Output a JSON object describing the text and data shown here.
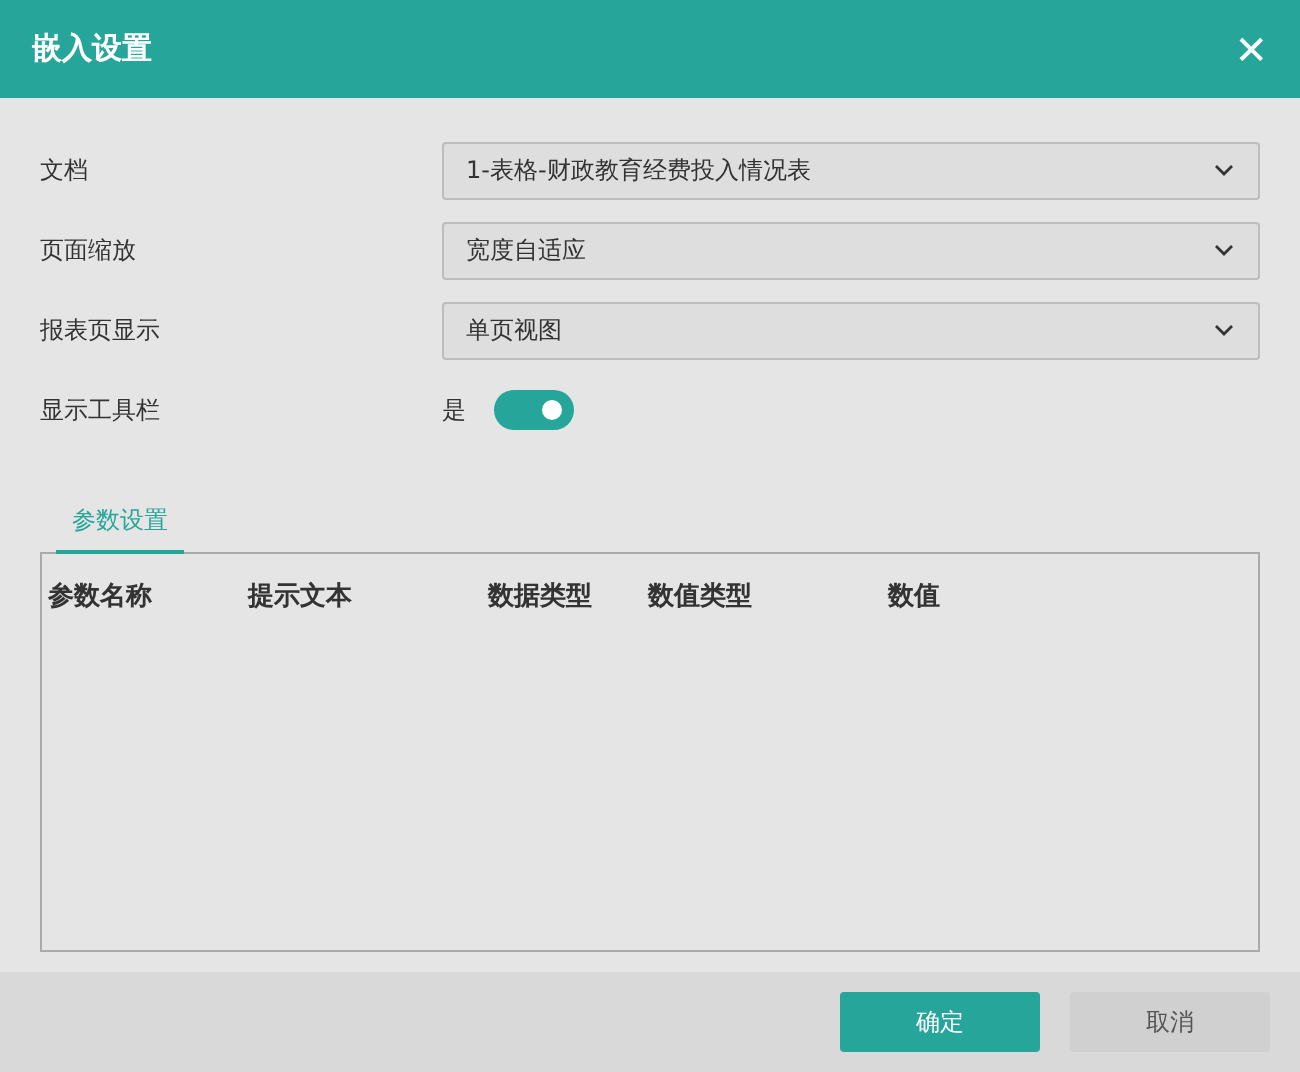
{
  "window": {
    "title": "嵌入设置",
    "close": "✕"
  },
  "fields": [
    {
      "kind": "select",
      "label": "文档",
      "value": "1-表格-财政教育经费投入情况表"
    },
    {
      "kind": "select",
      "label": "页面缩放",
      "value": "宽度自适应"
    },
    {
      "kind": "select",
      "label": "报表页显示",
      "value": "单页视图"
    },
    {
      "kind": "toggle",
      "label": "显示工具栏",
      "value": "是",
      "on": true
    }
  ],
  "tabs": [
    {
      "label": "参数设置",
      "selected": true
    }
  ],
  "table": {
    "columns": [
      "参数名称",
      "提示文本",
      "数据类型",
      "数值类型",
      "数值"
    ]
  },
  "buttons": [
    {
      "label": "确定",
      "primary": true
    },
    {
      "label": "取消",
      "primary": false
    }
  ]
}
